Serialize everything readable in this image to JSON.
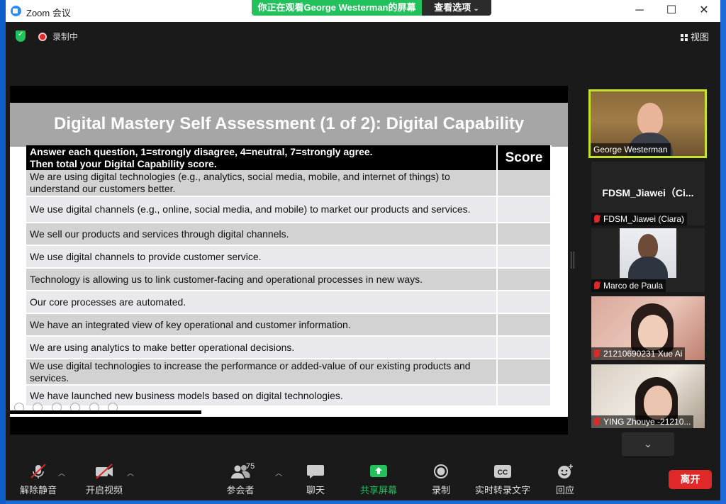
{
  "window": {
    "title": "Zoom 会议",
    "share_banner": "你正在观看George  Westerman的屏幕",
    "view_options": "查看选项",
    "minimize": "─",
    "maximize": "☐",
    "close": "✕"
  },
  "topbar": {
    "recording_label": "录制中",
    "view_label": "视图"
  },
  "slide": {
    "title": "Digital Mastery Self Assessment (1 of 2): Digital Capability",
    "header_instruction_line1": "Answer each question, 1=strongly disagree, 4=neutral, 7=strongly agree.",
    "header_instruction_line2": "Then total your Digital Capability score.",
    "header_score": "Score",
    "questions": [
      "We are using digital technologies (e.g., analytics, social media, mobile, and internet of things) to understand our customers better.",
      "We use digital channels (e.g., online, social media, and mobile) to market our products and services.",
      "We sell our products and services through digital channels.",
      "We use digital channels to provide customer service.",
      "Technology is allowing us to link customer-facing and operational processes in new ways.",
      "Our core processes are automated.",
      "We have an integrated view of key operational and customer information.",
      "We are using analytics to make better operational decisions.",
      "We use digital technologies to increase the performance or added-value of our existing products and services.",
      "We have launched new business models based on digital technologies."
    ]
  },
  "gallery": {
    "participants": [
      {
        "name": "George Westerman",
        "muted": false,
        "active_speaker": true
      },
      {
        "name": "FDSM_Jiawei (Ciara)",
        "display_big": "FDSM_Jiawei（Ci...",
        "muted": true
      },
      {
        "name": "Marco de Paula",
        "muted": true
      },
      {
        "name": "21210690231 Xue Ai",
        "muted": true
      },
      {
        "name": "YING Zhouye  -21210...",
        "muted": true
      }
    ],
    "scroll_down": "⌄"
  },
  "toolbar": {
    "unmute": "解除静音",
    "start_video": "开启视频",
    "participants": "参会者",
    "participants_count": "75",
    "chat": "聊天",
    "share_screen": "共享屏幕",
    "record": "录制",
    "live_transcript": "实时转录文字",
    "reactions": "回应",
    "cc": "CC",
    "leave": "离开"
  },
  "colors": {
    "accent_green": "#23c15c",
    "leave_red": "#e02828",
    "active_border": "#c5e32a",
    "zoom_blue": "#2d8cff"
  }
}
